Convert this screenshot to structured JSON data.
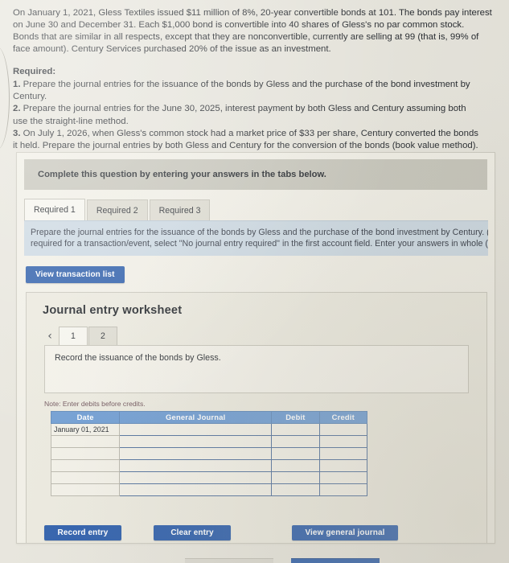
{
  "problem": {
    "paragraph_lines": [
      "On January 1, 2021, Gless Textiles issued $11 million of 8%, 20-year convertible bonds at 101. The bonds pay interest",
      "on June 30 and December 31. Each $1,000 bond is convertible into 40 shares of Gless's no par common stock.",
      "Bonds that are similar in all respects, except that they are nonconvertible, currently are selling at 99 (that is, 99% of",
      "face amount). Century Services purchased 20% of the issue as an investment."
    ]
  },
  "required": {
    "heading": "Required:",
    "items": [
      {
        "number": "1.",
        "lines": [
          "Prepare the journal entries for the issuance of the bonds by Gless and the purchase of the bond investment by",
          "Century."
        ]
      },
      {
        "number": "2.",
        "lines": [
          "Prepare the journal entries for the June 30, 2025, interest payment by both Gless and Century assuming both",
          "use the straight-line method."
        ]
      },
      {
        "number": "3.",
        "lines": [
          "On July 1, 2026, when Gless's common stock had a market price of $33 per share, Century converted the bonds",
          "it held. Prepare the journal entries by both Gless and Century for the conversion of the bonds (book value method)."
        ]
      }
    ]
  },
  "card": {
    "banner_text": "Complete this question by entering your answers in the tabs below.",
    "tabs": [
      {
        "label": "Required 1",
        "active": true
      },
      {
        "label": "Required 2",
        "active": false
      },
      {
        "label": "Required 3",
        "active": false
      }
    ],
    "instruction_lines": [
      "Prepare the journal entries for the issuance of the bonds by Gless and the purchase of the bond investment by Century. (I",
      "required for a transaction/event, select \"No journal entry required\" in the first account field. Enter your answers in whole ("
    ],
    "view_transaction_list_label": "View transaction list"
  },
  "worksheet": {
    "title": "Journal entry worksheet",
    "prev_arrow_icon": "chevron-left-icon",
    "next_arrow_icon": "chevron-right-icon",
    "pages": [
      {
        "label": "1",
        "active": true
      },
      {
        "label": "2",
        "active": false
      }
    ],
    "record_prompt": "Record the issuance of the bonds by Gless.",
    "note": "Note: Enter debits before credits.",
    "table": {
      "headers": [
        "Date",
        "General Journal",
        "Debit",
        "Credit"
      ],
      "rows": [
        {
          "date": "January 01, 2021",
          "general_journal": "",
          "debit": "",
          "credit": ""
        },
        {
          "date": "",
          "general_journal": "",
          "debit": "",
          "credit": ""
        },
        {
          "date": "",
          "general_journal": "",
          "debit": "",
          "credit": ""
        },
        {
          "date": "",
          "general_journal": "",
          "debit": "",
          "credit": ""
        },
        {
          "date": "",
          "general_journal": "",
          "debit": "",
          "credit": ""
        },
        {
          "date": "",
          "general_journal": "",
          "debit": "",
          "credit": ""
        }
      ]
    },
    "buttons": {
      "record_entry": "Record entry",
      "clear_entry": "Clear entry",
      "view_general_journal": "View general journal"
    }
  },
  "colors": {
    "page_background": "#e8e6dd",
    "banner": "#c7c6bb",
    "instruction_strip": "#ccd9e3",
    "primary_button": "#2a5caa",
    "table_header": "#6c9bd2",
    "table_cell_border": "#4f6f9c",
    "note_text": "#6b4f56"
  }
}
